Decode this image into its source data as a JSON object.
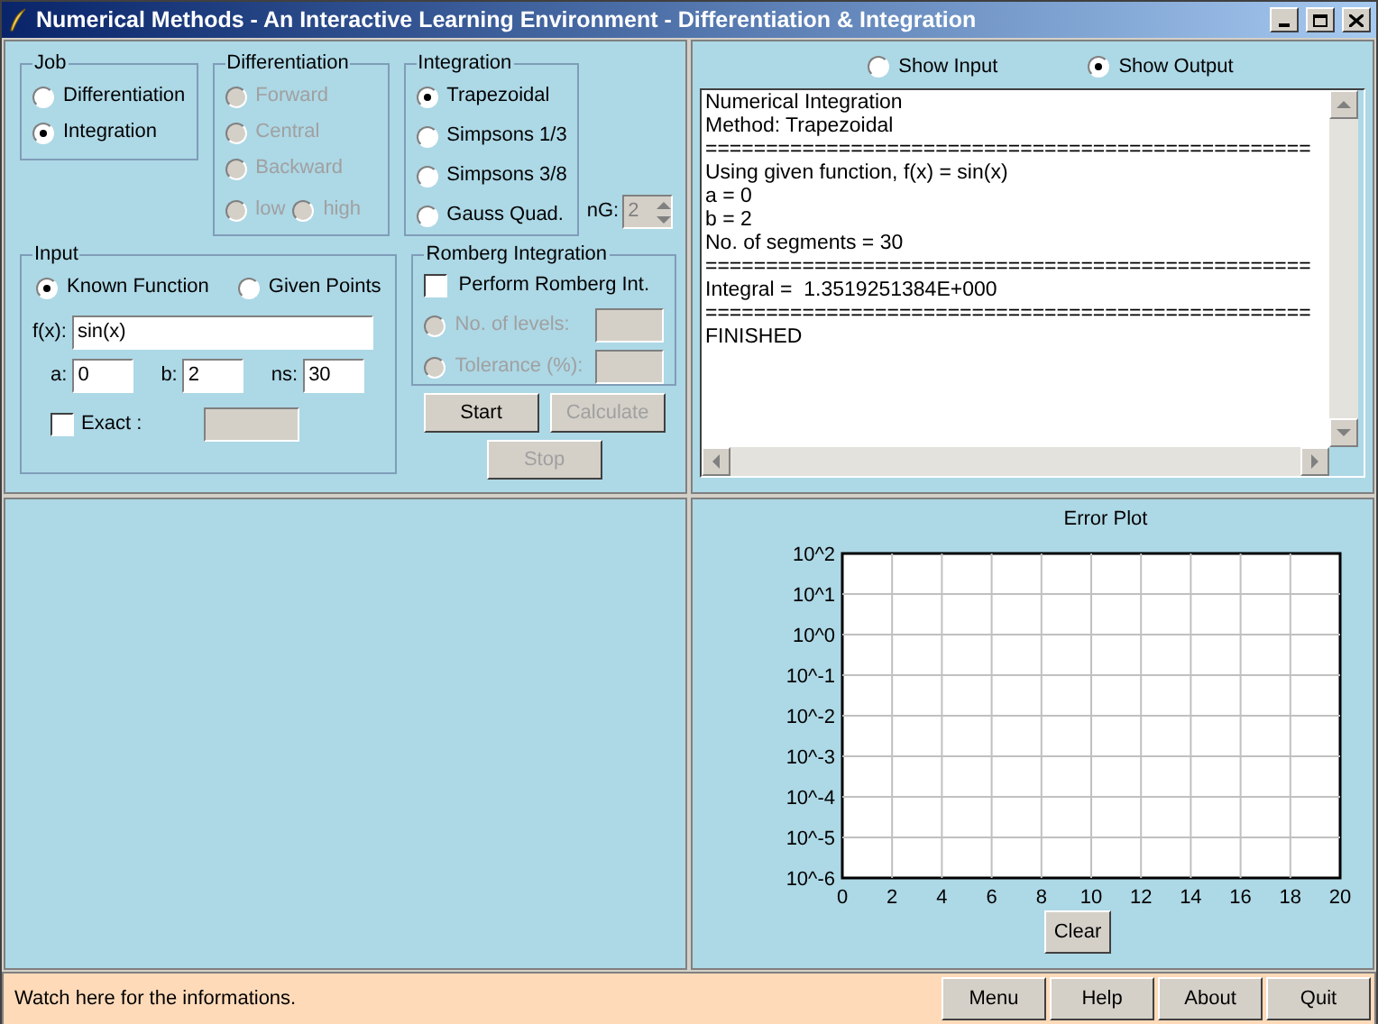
{
  "window": {
    "title": "Numerical Methods - An Interactive Learning Environment - Differentiation & Integration"
  },
  "job": {
    "title": "Job",
    "options": [
      {
        "label": "Differentiation",
        "selected": false
      },
      {
        "label": "Integration",
        "selected": true
      }
    ]
  },
  "differentiation": {
    "title": "Differentiation",
    "disabled": true,
    "options": [
      {
        "label": "Forward",
        "selected": false
      },
      {
        "label": "Central",
        "selected": false
      },
      {
        "label": "Backward",
        "selected": false
      }
    ],
    "order_options": [
      {
        "label": "low",
        "selected": false
      },
      {
        "label": "high",
        "selected": false
      }
    ]
  },
  "integration": {
    "title": "Integration",
    "options": [
      {
        "label": "Trapezoidal",
        "selected": true
      },
      {
        "label": "Simpsons 1/3",
        "selected": false
      },
      {
        "label": "Simpsons 3/8",
        "selected": false
      },
      {
        "label": "Gauss Quad.",
        "selected": false
      }
    ]
  },
  "gauss_points": {
    "label": "nG:",
    "value": "2",
    "disabled": true
  },
  "input": {
    "title": "Input",
    "sources": [
      {
        "label": "Known Function",
        "selected": true
      },
      {
        "label": "Given Points",
        "selected": false
      }
    ],
    "function": {
      "label": "f(x):",
      "value": "sin(x)"
    },
    "params": [
      {
        "label": "a:",
        "value": "0"
      },
      {
        "label": "b:",
        "value": "2"
      },
      {
        "label": "ns:",
        "value": "30"
      }
    ],
    "exact": {
      "label": "Exact :",
      "checked": false
    }
  },
  "romberg": {
    "title": "Romberg Integration",
    "perform": {
      "label": "Perform Romberg Int.",
      "checked": false
    },
    "criteria": [
      {
        "label": "No. of levels:",
        "selected": false,
        "disabled": true
      },
      {
        "label": "Tolerance (%):",
        "selected": false,
        "disabled": true
      }
    ]
  },
  "actions": [
    {
      "label": "Start",
      "disabled": false
    },
    {
      "label": "Calculate",
      "disabled": true
    },
    {
      "label": "Stop",
      "disabled": true
    }
  ],
  "output": {
    "views": [
      {
        "label": "Show Input",
        "selected": false
      },
      {
        "label": "Show Output",
        "selected": true
      }
    ],
    "lines": [
      "Numerical Integration",
      "Method: Trapezoidal",
      "==================================================",
      "Using given function, f(x) = sin(x)",
      "a = 0",
      "b = 2",
      "No. of segments = 30",
      "==================================================",
      "Integral =  1.3519251384E+000",
      "==================================================",
      "FINISHED"
    ]
  },
  "error_plot": {
    "title": "Error Plot",
    "y_axis_labels": [
      "10^2",
      "10^1",
      "10^0",
      "10^-1",
      "10^-2",
      "10^-3",
      "10^-4",
      "10^-5",
      "10^-6"
    ],
    "x_axis_labels": [
      "0",
      "2",
      "4",
      "6",
      "8",
      "10",
      "12",
      "14",
      "16",
      "18",
      "20"
    ],
    "clear_button": "Clear"
  },
  "status_bar": {
    "message": "Watch here for the informations.",
    "buttons": [
      "Menu",
      "Help",
      "About",
      "Quit"
    ]
  }
}
